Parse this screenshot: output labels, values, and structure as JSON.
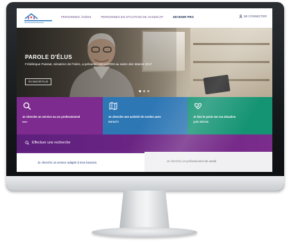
{
  "header": {
    "nav_items": [
      "PERSONNES ÂGÉES",
      "PERSONNES EN SITUATION DE HANDICAP",
      "DEVENIR PRO"
    ],
    "active_index": 2,
    "login_label": "SE CONNECTER"
  },
  "hero": {
    "title": "PAROLE D'ÉLUS",
    "subtitle": "Frédérique Puissat, sénatrice de l'Isère, a présenté IsèreADOM au salon des Maires 2017",
    "more_label": "EN SAVOIR PLUS",
    "slide_count": 3,
    "active_slide": 0
  },
  "tiles": [
    {
      "label": "Je cherche un service ou un professionnel",
      "sub": "Isère",
      "color": "#7d2b8e",
      "icon": "search-icon"
    },
    {
      "label": "Je cherche une activité de sorties avec",
      "sub": "ENFANTS",
      "color": "#2e77b5",
      "icon": "map-icon"
    },
    {
      "label": "Je fais le point sur ma situation",
      "sub": "QUEL BESOIN",
      "color": "#159474",
      "icon": "heart-hands-icon"
    }
  ],
  "search_band": {
    "label": "Effectuer une recherche"
  },
  "tabs": [
    {
      "label": "Je cherche un service adapté à mes besoins",
      "active": true
    },
    {
      "label": "Je cherche un professionnel de santé",
      "active": false
    }
  ]
}
